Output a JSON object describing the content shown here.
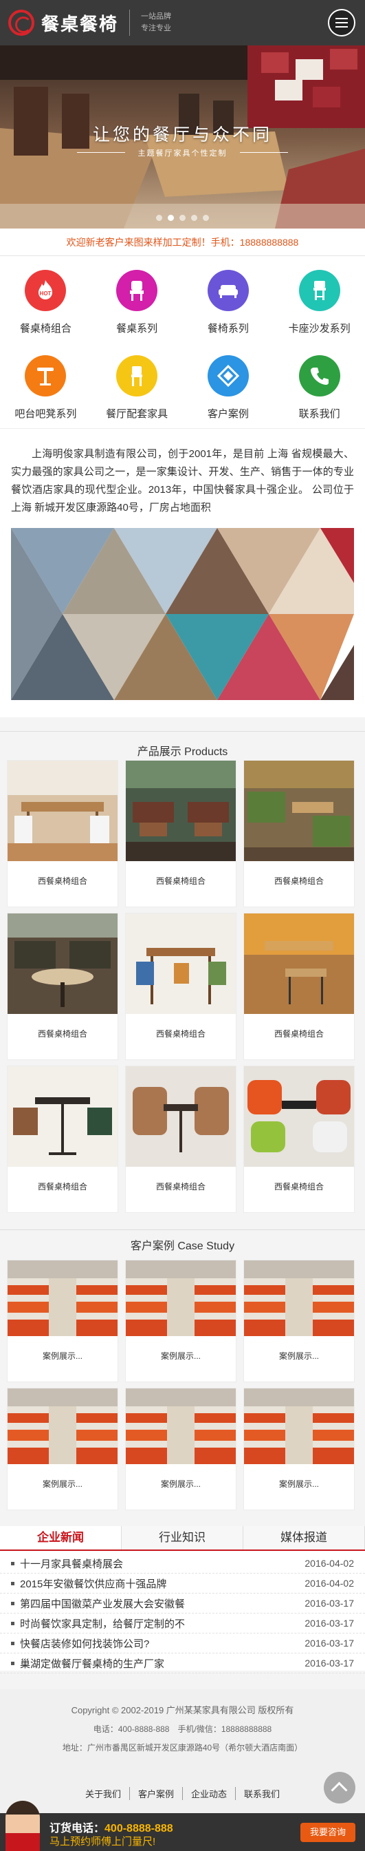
{
  "header": {
    "logo_text": "餐桌餐椅",
    "slogan_1": "一站品牌",
    "slogan_2": "专注专业"
  },
  "banner": {
    "title": "让您的餐厅与众不同",
    "subtitle": "主题餐厅家具个性定制",
    "slide_count": 5,
    "active_slide": 2
  },
  "welcome": "欢迎新老客户来图来样加工定制！手机：18888888888",
  "nav": [
    {
      "label": "餐桌椅组合",
      "icon": "hot-icon",
      "color": "#ec3a3a"
    },
    {
      "label": "餐桌系列",
      "icon": "chair-icon",
      "color": "#d31fa9"
    },
    {
      "label": "餐椅系列",
      "icon": "sofa-icon",
      "color": "#6a55d9"
    },
    {
      "label": "卡座沙发系列",
      "icon": "stool-icon",
      "color": "#21c5b4"
    },
    {
      "label": "吧台吧凳系列",
      "icon": "bar-table-icon",
      "color": "#f47c13"
    },
    {
      "label": "餐厅配套家具",
      "icon": "bar-chair-icon",
      "color": "#f6c615"
    },
    {
      "label": "客户案例",
      "icon": "cases-icon",
      "color": "#2b94e3"
    },
    {
      "label": "联系我们",
      "icon": "phone-icon",
      "color": "#2ea042"
    }
  ],
  "about": {
    "text": "上海明俊家具制造有限公司，创于2001年，是目前 上海 省规模最大、实力最强的家具公司之一，是一家集设计、开发、生产、销售于一体的专业餐饮酒店家具的现代型企业。2013年，中国快餐家具十强企业。 公司位于 上海 新城开发区康源路40号，厂房占地面积"
  },
  "products": {
    "title": "产品展示 Products",
    "items": [
      {
        "caption": "西餐桌椅组合"
      },
      {
        "caption": "西餐桌椅组合"
      },
      {
        "caption": "西餐桌椅组合"
      },
      {
        "caption": "西餐桌椅组合"
      },
      {
        "caption": "西餐桌椅组合"
      },
      {
        "caption": "西餐桌椅组合"
      },
      {
        "caption": "西餐桌椅组合"
      },
      {
        "caption": "西餐桌椅组合"
      },
      {
        "caption": "西餐桌椅组合"
      }
    ]
  },
  "cases": {
    "title": "客户案例 Case Study",
    "items": [
      {
        "caption": "案例展示..."
      },
      {
        "caption": "案例展示..."
      },
      {
        "caption": "案例展示..."
      },
      {
        "caption": "案例展示..."
      },
      {
        "caption": "案例展示..."
      },
      {
        "caption": "案例展示..."
      }
    ]
  },
  "news": {
    "tabs": [
      "企业新闻",
      "行业知识",
      "媒体报道"
    ],
    "items": [
      {
        "title": "十一月家具餐桌椅展会",
        "date": "2016-04-02"
      },
      {
        "title": "2015年安徽餐饮供应商十强品牌",
        "date": "2016-04-02"
      },
      {
        "title": "第四届中国徽菜产业发展大会安徽餐",
        "date": "2016-03-17"
      },
      {
        "title": "时尚餐饮家具定制，给餐厅定制的不",
        "date": "2016-03-17"
      },
      {
        "title": "快餐店装修如何找装饰公司?",
        "date": "2016-03-17"
      },
      {
        "title": "巢湖定做餐厅餐桌椅的生产厂家",
        "date": "2016-03-17"
      }
    ]
  },
  "footer": {
    "copyright": "Copyright © 2002-2019 广州某某家具有限公司 版权所有",
    "contact": "电话：400-8888-888　手机/微信：18888888888",
    "address": "地址：广州市番禺区新城开发区康源路40号（希尔顿大酒店南面）",
    "links": [
      "关于我们",
      "客户案例",
      "企业动态",
      "联系我们"
    ]
  },
  "callbar": {
    "line1_label": "订货电话：",
    "line1_number": "400-8888-888",
    "line2": "马上预约师傅上门量尺!",
    "button": "我要咨询"
  }
}
